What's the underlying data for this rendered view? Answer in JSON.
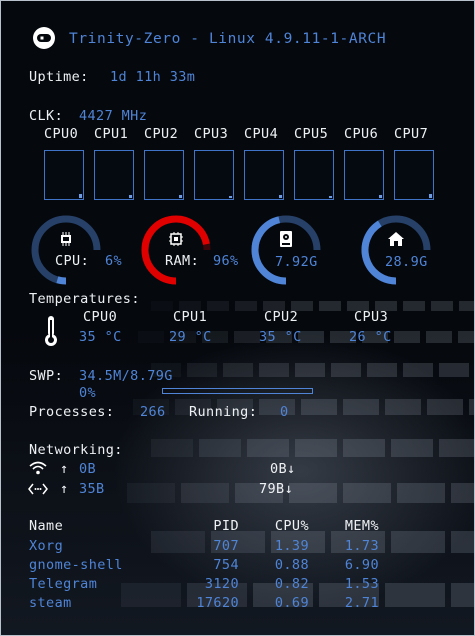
{
  "header": {
    "logo_icon": "arch-logo-icon",
    "title": "Trinity-Zero - Linux 4.9.11-1-ARCH"
  },
  "uptime": {
    "label": "Uptime:",
    "value": "1d 11h 33m"
  },
  "clock": {
    "label": "CLK:",
    "value": "4427 MHz"
  },
  "cpus": [
    "CPU0",
    "CPU1",
    "CPU2",
    "CPU3",
    "CPU4",
    "CPU5",
    "CPU6",
    "CPU7"
  ],
  "gauges": [
    {
      "name": "cpu",
      "icon": "cpu-chip-icon",
      "label": "CPU:",
      "value": "6%",
      "fraction": 0.06,
      "color": "#4f84d6"
    },
    {
      "name": "ram",
      "icon": "memory-chip-icon",
      "label": "RAM:",
      "value": "96%",
      "fraction": 0.96,
      "color": "#e00000"
    },
    {
      "name": "disk",
      "icon": "hard-drive-icon",
      "label": "",
      "value": "7.92G",
      "fraction": 0.62,
      "color": "#4f84d6"
    },
    {
      "name": "home",
      "icon": "home-icon",
      "label": "",
      "value": "28.9G",
      "fraction": 0.55,
      "color": "#4f84d6"
    }
  ],
  "temperatures": {
    "label": "Temperatures:",
    "icon": "thermometer-icon",
    "items": [
      {
        "name": "CPU0",
        "value": "35 °C"
      },
      {
        "name": "CPU1",
        "value": "29 °C"
      },
      {
        "name": "CPU2",
        "value": "35 °C"
      },
      {
        "name": "CPU3",
        "value": "26 °C"
      }
    ]
  },
  "swap": {
    "label": "SWP:",
    "value": "34.5M/8.79G",
    "percent": "0%",
    "fraction": 0.0
  },
  "processes": {
    "label": "Processes:",
    "value": "266",
    "running_label": "Running:",
    "running_value": "0"
  },
  "networking": {
    "label": "Networking:",
    "interfaces": [
      {
        "icon": "wifi-icon",
        "up_arrow": "↑",
        "up": "0B",
        "down": "0B↓"
      },
      {
        "icon": "ethernet-icon",
        "up_arrow": "↑",
        "up": "35B",
        "down": "79B↓"
      }
    ]
  },
  "process_table": {
    "headers": {
      "name": "Name",
      "pid": "PID",
      "cpu": "CPU%",
      "mem": "MEM%"
    },
    "rows": [
      {
        "name": "Xorg",
        "pid": "707",
        "cpu": "1.39",
        "mem": "1.73"
      },
      {
        "name": "gnome-shell",
        "pid": "754",
        "cpu": "0.88",
        "mem": "6.90"
      },
      {
        "name": "Telegram",
        "pid": "3120",
        "cpu": "0.82",
        "mem": "1.53"
      },
      {
        "name": "steam",
        "pid": "17620",
        "cpu": "0.69",
        "mem": "2.71"
      }
    ]
  },
  "colors": {
    "accent": "#4f84d6",
    "text": "#eef1f4",
    "alert": "#e00000",
    "background": "#05080d"
  }
}
